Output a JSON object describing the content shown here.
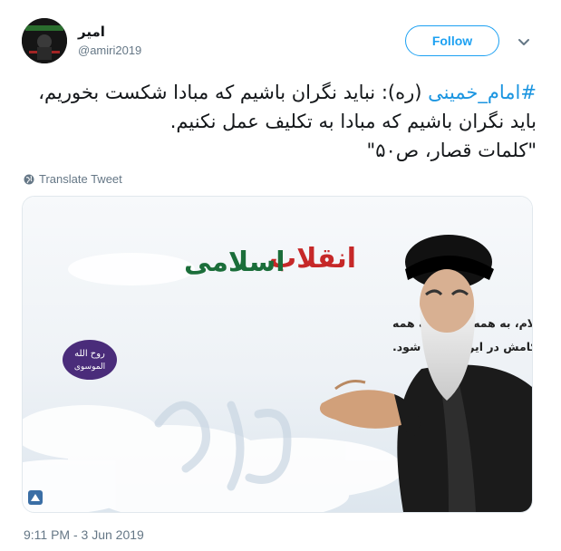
{
  "author": {
    "display_name": "امیر",
    "handle": "@amiri2019"
  },
  "follow_label": "Follow",
  "tweet": {
    "hashtag": "#امام_خمینی",
    "line1_rest": " (ره): نباید نگران باشیم که مبادا شکست بخوریم،",
    "line2": "باید نگران باشیم که مبادا به تکلیف عمل نکنیم.",
    "line3": "\"کلمات قصار، ص۵۰\""
  },
  "translate_label": "Translate Tweet",
  "media": {
    "title_part1": "انقلاب",
    "title_part2": "اسلامی",
    "quote_line1": "پیروزی نمایی وقتی است که اسلام، به همه ابعاد و به همه",
    "quote_line2": "احکامش در ایران پیاده شود.",
    "seal_line1": "روح الله",
    "seal_line2": "الموسوی"
  },
  "timestamp": "9:11 PM - 3 Jun 2019",
  "colors": {
    "accent": "#1da1f2",
    "hashtag": "#1b95e0",
    "muted": "#657786",
    "title_red": "#c62828",
    "title_green": "#1b6e3a",
    "seal_purple": "#4a2c7a"
  }
}
